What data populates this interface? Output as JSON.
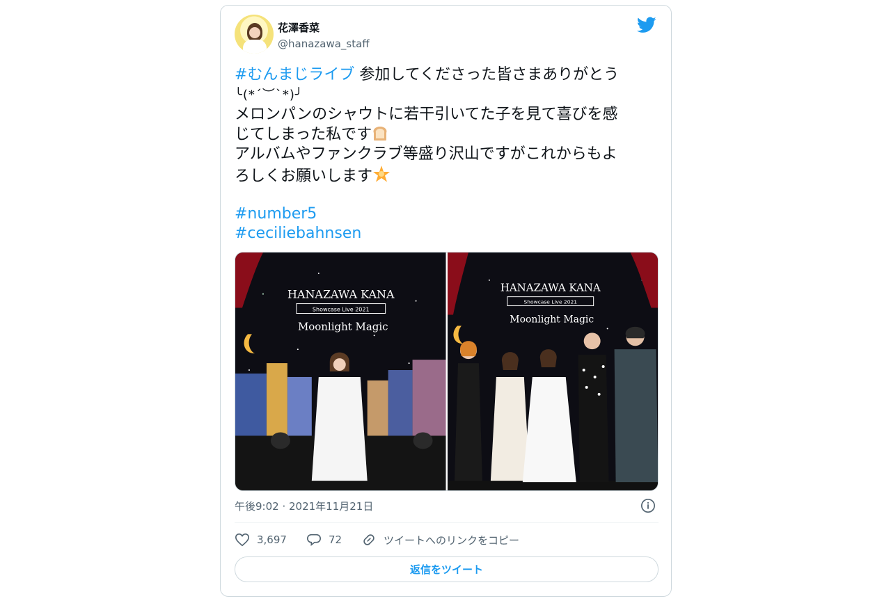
{
  "author": {
    "display_name": "花澤香菜",
    "handle": "@hanazawa_staff"
  },
  "tweet": {
    "lines": [
      {
        "tag": "#むんまじライブ",
        "text": " 参加してくださった皆さまありがとう"
      },
      {
        "kaomoji": "╰(*´︶`*)╯"
      },
      {
        "text": "メロンパンのシャウトに若干引いてた子を見て喜びを感"
      },
      {
        "text": "じてしまった私です"
      },
      {
        "text": "アルバムやファンクラブ等盛り沢山ですがこれからもよ"
      },
      {
        "text": "ろしくお願いします"
      }
    ],
    "hashtags": [
      "#number5",
      "#ceciliebahnsen"
    ]
  },
  "photos": [
    {
      "title": "HANAZAWA KANA",
      "subtitle": "Showcase Live 2021",
      "show": "Moonlight Magic"
    },
    {
      "title": "HANAZAWA KANA",
      "subtitle": "Showcase Live 2021",
      "show": "Moonlight Magic"
    }
  ],
  "timestamp": "午後9:02 · 2021年11月21日",
  "actions": {
    "likes": "3,697",
    "replies": "72",
    "copy_link": "ツイートへのリンクをコピー"
  },
  "reply_button": "返信をツイート",
  "colors": {
    "accent": "#1d9bf0",
    "text": "#0f1419",
    "muted": "#536471",
    "border": "#cfd9de"
  },
  "icons": [
    "twitter-bird-icon",
    "bread-emoji",
    "star-emoji",
    "info-icon",
    "heart-icon",
    "reply-bubble-icon",
    "link-icon"
  ]
}
